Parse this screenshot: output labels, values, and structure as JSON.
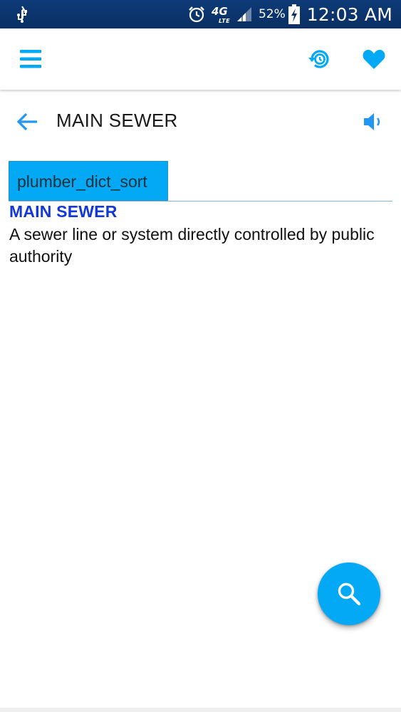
{
  "status_bar": {
    "battery_percent": "52%",
    "time": "12:03 AM",
    "network_type": "4G",
    "network_sub": "LTE"
  },
  "app_bar": {
    "menu_icon": "hamburger-menu-icon",
    "history_icon": "history-icon",
    "favorite_icon": "heart-icon"
  },
  "word": {
    "title": "MAIN SEWER"
  },
  "source": {
    "tag": "plumber_dict_sort"
  },
  "entry": {
    "term": "MAIN SEWER",
    "definition": "A sewer line or system directly controlled by public authority"
  },
  "colors": {
    "accent": "#03a9f4",
    "term": "#1238d8",
    "status_bar": "#0d3a78"
  }
}
